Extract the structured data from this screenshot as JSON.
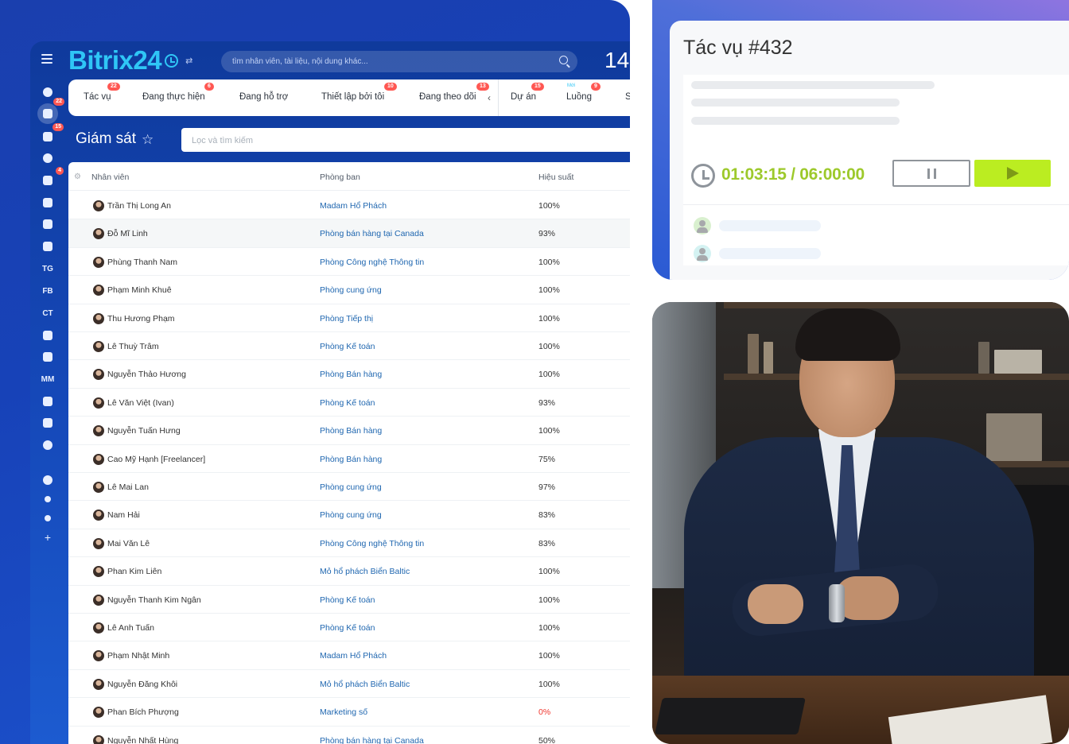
{
  "app": {
    "logo": "Bitrix24",
    "search_placeholder": "tìm nhân viên, tài liệu, nội dung khác...",
    "clock": "14"
  },
  "sidebar": {
    "items": [
      {
        "icon": "activity-icon",
        "label": ""
      },
      {
        "icon": "tasks-icon",
        "label": "",
        "badge": "22"
      },
      {
        "icon": "filter-icon",
        "label": "",
        "badge": "15"
      },
      {
        "icon": "target-icon",
        "label": ""
      },
      {
        "icon": "contacts-icon",
        "label": "",
        "badge": "4"
      },
      {
        "icon": "cart-icon",
        "label": ""
      },
      {
        "icon": "robot-icon",
        "label": ""
      },
      {
        "icon": "box-icon",
        "label": ""
      },
      {
        "icon": "",
        "label": "TG"
      },
      {
        "icon": "",
        "label": "FB"
      },
      {
        "icon": "",
        "label": "CT"
      },
      {
        "icon": "store-icon",
        "label": ""
      },
      {
        "icon": "sign-icon",
        "label": ""
      },
      {
        "icon": "",
        "label": "MM"
      },
      {
        "icon": "chart-icon",
        "label": ""
      },
      {
        "icon": "edit-list-icon",
        "label": ""
      },
      {
        "icon": "chevron-circle-icon",
        "label": ""
      },
      {
        "icon": "help-icon",
        "label": ""
      },
      {
        "icon": "network-icon",
        "label": ""
      },
      {
        "icon": "settings-icon",
        "label": ""
      },
      {
        "icon": "plus-icon",
        "label": ""
      }
    ]
  },
  "tabs": [
    {
      "label": "Tác vụ",
      "badge": "22"
    },
    {
      "label": "Đang thực hiện",
      "badge": "6"
    },
    {
      "label": "Đang hỗ trợ",
      "badge": ""
    },
    {
      "label": "Thiết lập bởi tôi",
      "badge": "10"
    },
    {
      "label": "Đang theo dõi",
      "badge": "13"
    },
    {
      "label": "Dự án",
      "badge": "15"
    },
    {
      "label": "Luồng",
      "badge": "9",
      "new": "Mới"
    },
    {
      "label": "S",
      "badge": ""
    }
  ],
  "page": {
    "title": "Giám sát",
    "filter_placeholder": "Lọc và tìm kiếm"
  },
  "table": {
    "columns": [
      "Nhân viên",
      "Phòng ban",
      "Hiệu suất"
    ],
    "rows": [
      {
        "name": "Trần Thị Long An",
        "dept": "Madam Hổ Phách",
        "perf": "100%"
      },
      {
        "name": "Đỗ Mĩ Linh",
        "dept": "Phòng bán hàng tại Canada",
        "perf": "93%"
      },
      {
        "name": "Phùng Thanh Nam",
        "dept": "Phòng Công nghệ Thông tin",
        "perf": "100%"
      },
      {
        "name": "Phạm Minh Khuê",
        "dept": "Phòng cung ứng",
        "perf": "100%"
      },
      {
        "name": "Thu Hương Phạm",
        "dept": "Phòng Tiếp thị",
        "perf": "100%"
      },
      {
        "name": "Lê Thuỳ Trâm",
        "dept": "Phòng Kế toán",
        "perf": "100%"
      },
      {
        "name": "Nguyễn Thảo Hương",
        "dept": "Phòng Bán hàng",
        "perf": "100%"
      },
      {
        "name": "Lê Văn Việt (Ivan)",
        "dept": "Phòng Kế toán",
        "perf": "93%"
      },
      {
        "name": "Nguyễn Tuấn Hưng",
        "dept": "Phòng Bán hàng",
        "perf": "100%"
      },
      {
        "name": "Cao Mỹ Hạnh [Freelancer]",
        "dept": "Phòng Bán hàng",
        "perf": "75%"
      },
      {
        "name": "Lê Mai Lan",
        "dept": "Phòng cung ứng",
        "perf": "97%"
      },
      {
        "name": "Nam Hải",
        "dept": "Phòng cung ứng",
        "perf": "83%"
      },
      {
        "name": "Mai Văn Lê",
        "dept": "Phòng Công nghệ Thông tin",
        "perf": "83%"
      },
      {
        "name": "Phan Kim Liên",
        "dept": "Mỏ hổ phách Biển Baltic",
        "perf": "100%"
      },
      {
        "name": "Nguyễn Thanh Kim Ngân",
        "dept": "Phòng Kế toán",
        "perf": "100%"
      },
      {
        "name": "Lê Anh Tuấn",
        "dept": "Phòng Kế toán",
        "perf": "100%"
      },
      {
        "name": "Phạm Nhật Minh",
        "dept": "Madam Hổ Phách",
        "perf": "100%"
      },
      {
        "name": "Nguyễn Đăng Khôi",
        "dept": "Mỏ hổ phách Biển Baltic",
        "perf": "100%"
      },
      {
        "name": "Phan Bích Phượng",
        "dept": "Marketing số",
        "perf": "0%"
      },
      {
        "name": "Nguyễn Nhất Hùng",
        "dept": "Phòng bán hàng tại Canada",
        "perf": "50%"
      }
    ]
  },
  "task": {
    "title": "Tác vụ #432",
    "timer": "01:03:15 / 06:00:00",
    "timer_color": "#9dc92b",
    "play_color": "#bbed21"
  },
  "colors": {
    "brand": "#2fc6f6",
    "link": "#2067b0",
    "badge": "#ff5752",
    "negative": "#f0372f"
  }
}
